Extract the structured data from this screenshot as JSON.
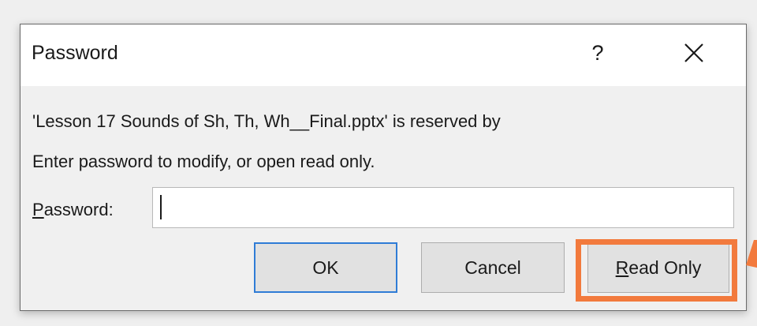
{
  "dialog": {
    "title": "Password",
    "help_label": "?",
    "message_line1": "'Lesson 17 Sounds of Sh, Th, Wh__Final.pptx' is reserved by",
    "message_line2": "Enter password to modify, or open read only.",
    "password_label_accel": "P",
    "password_label_rest": "assword:",
    "password_value": "",
    "ok_label": "OK",
    "cancel_label": "Cancel",
    "readonly_accel": "R",
    "readonly_rest": "ead Only"
  },
  "colors": {
    "highlight": "#f27a3d",
    "default_button_border": "#2f7cd6"
  }
}
